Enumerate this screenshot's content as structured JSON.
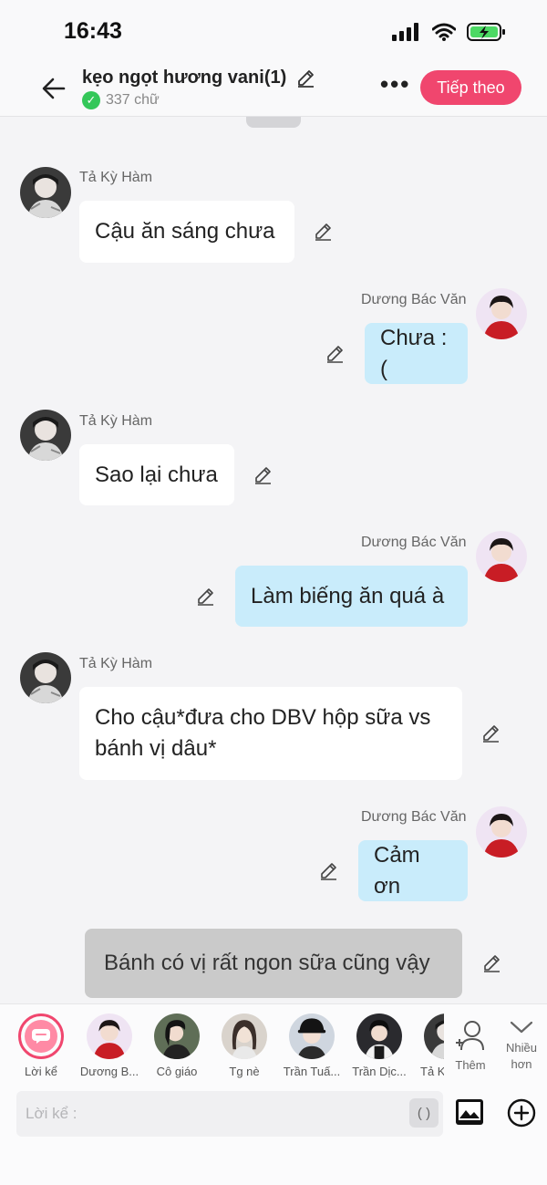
{
  "status": {
    "time": "16:43"
  },
  "header": {
    "title": "kẹo ngọt hương vani(1)",
    "word_count": "337 chữ",
    "more": "•••",
    "next_label": "Tiếp theo"
  },
  "messages": [
    {
      "side": "left",
      "name": "Tả Kỳ Hàm",
      "text": "Cậu ăn sáng chưa"
    },
    {
      "side": "right",
      "name": "Dương Bác Văn",
      "text": "Chưa :("
    },
    {
      "side": "left",
      "name": "Tả Kỳ Hàm",
      "text": "Sao lại chưa"
    },
    {
      "side": "right",
      "name": "Dương Bác Văn",
      "text": "Làm biếng ăn quá à"
    },
    {
      "side": "left",
      "name": "Tả Kỳ Hàm",
      "text": "Cho cậu*đưa cho DBV hộp sữa vs bánh vị dâu*"
    },
    {
      "side": "right",
      "name": "Dương Bác Văn",
      "text": "Cảm ơn"
    },
    {
      "side": "narration",
      "name": "",
      "text": "Bánh có vị rất ngon sữa cũng vậy"
    }
  ],
  "characters": [
    {
      "label": "Lời kể"
    },
    {
      "label": "Dương B..."
    },
    {
      "label": "Cô giáo"
    },
    {
      "label": "Tg nè"
    },
    {
      "label": "Trần Tuấ..."
    },
    {
      "label": "Trần Dịc..."
    },
    {
      "label": "Tả K"
    }
  ],
  "add_label": "Thêm",
  "more_label": "Nhiều\nhơn",
  "input": {
    "placeholder": "Lời kể :",
    "paren": "( )"
  },
  "colors": {
    "accent": "#f0466e",
    "right_bubble": "#c9ecfb",
    "left_bubble": "#ffffff",
    "narration_bubble": "#cacaca"
  }
}
